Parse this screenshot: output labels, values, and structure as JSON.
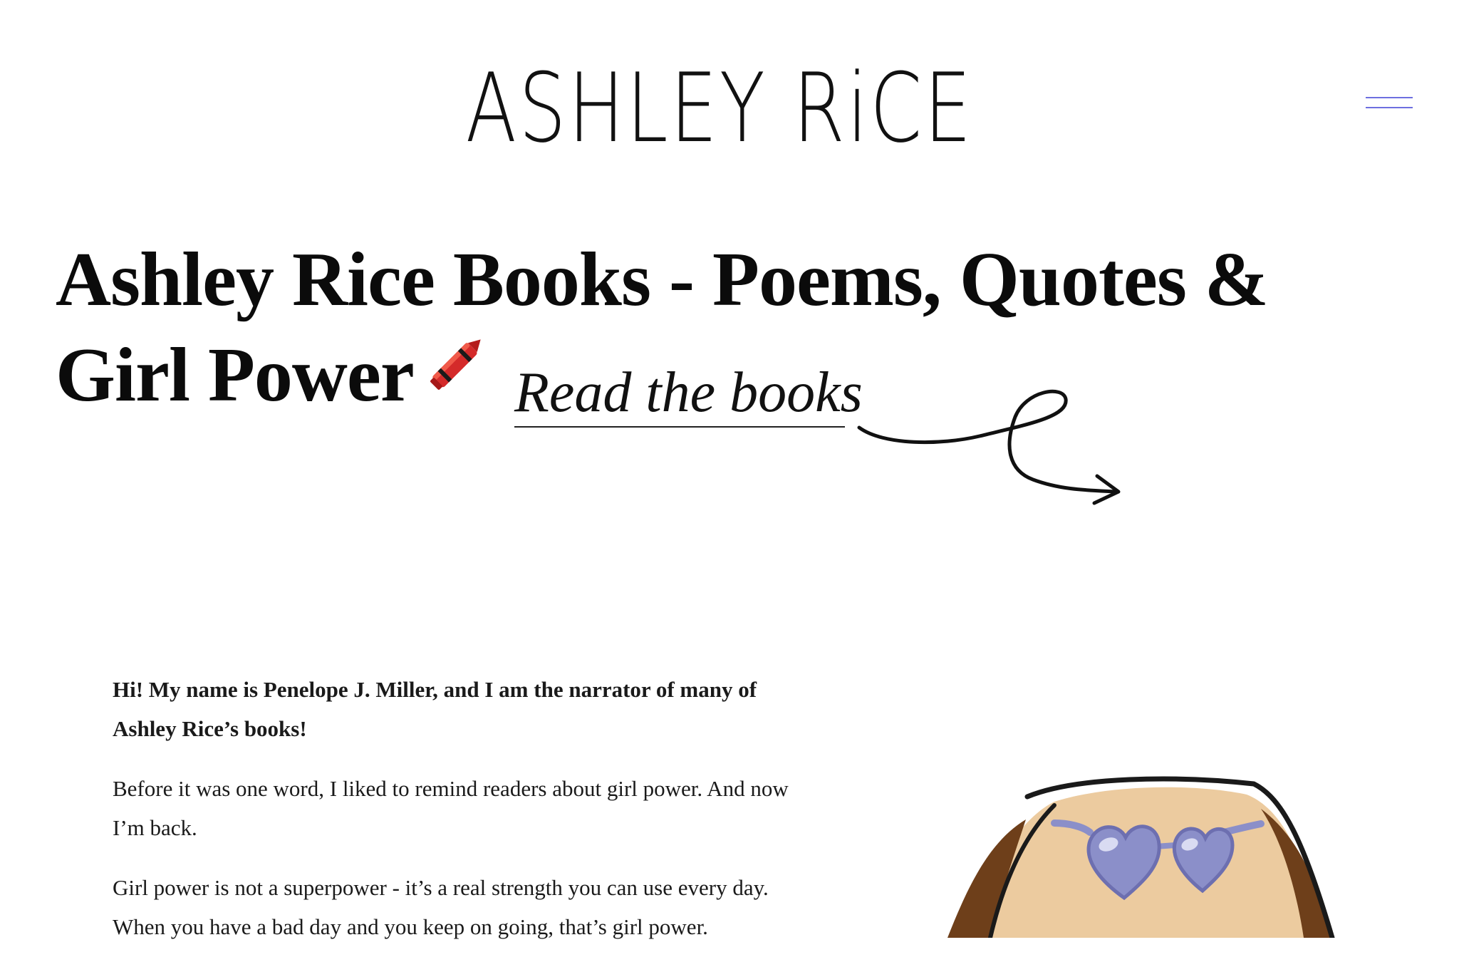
{
  "header": {
    "logo_text": "ASHLEY RiCE",
    "menu_icon": "hamburger-icon"
  },
  "hero": {
    "title": "Ashley Rice Books - Poems, Quotes & Girl Power",
    "title_icon": "crayon-icon",
    "cta_label": "Read the books",
    "cta_icon": "curly-arrow-icon"
  },
  "intro": {
    "lead": "Hi! My name is Penelope J. Miller, and I am the narrator of many of Ashley Rice’s books!",
    "paragraphs": [
      "Before it was one word, I liked to remind readers about girl power. And now I’m back.",
      "Girl power is not a superpower - it’s a real strength you can use every day. When you have a bad day and you keep on going, that’s girl power."
    ]
  },
  "colors": {
    "menu_lines": "#6d6fe0",
    "text": "#111111",
    "skin": "#eccb9f",
    "hair": "#6e3f1a",
    "glasses": "#8b8fc9"
  }
}
